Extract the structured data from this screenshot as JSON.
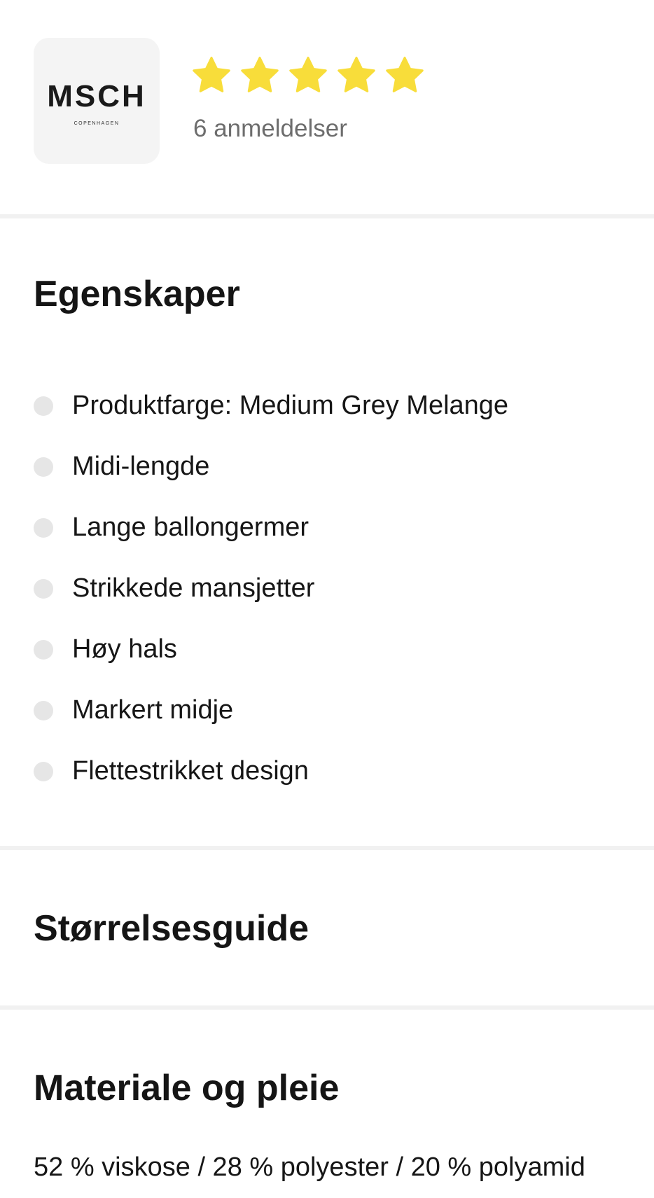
{
  "brand": {
    "logo_text": "MSCH",
    "logo_subtext": "COPENHAGEN",
    "rating": 5,
    "rating_max": 5,
    "star_color": "#f8dd3a",
    "reviews_label": "6 anmeldelser"
  },
  "properties": {
    "title": "Egenskaper",
    "items": [
      "Produktfarge: Medium Grey Melange",
      "Midi-lengde",
      "Lange ballongermer",
      "Strikkede mansjetter",
      "Høy hals",
      "Markert midje",
      "Flettestrikket design"
    ]
  },
  "size_guide": {
    "title": "Størrelsesguide"
  },
  "material": {
    "title": "Materiale og pleie",
    "composition": "52 % viskose / 28 % polyester / 20 % polyamid"
  }
}
